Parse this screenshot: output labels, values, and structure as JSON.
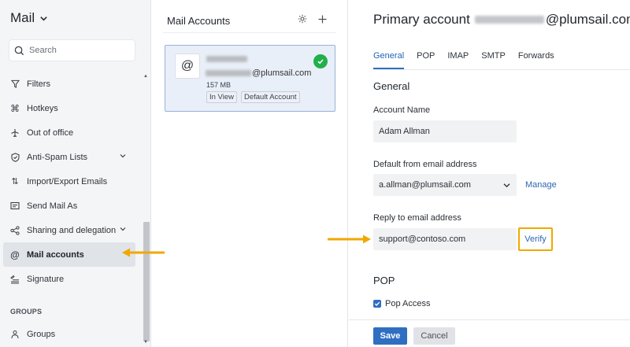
{
  "sidebar": {
    "app_title": "Mail",
    "search_placeholder": "Search",
    "items": [
      {
        "label": "Filters",
        "icon": "filter-icon"
      },
      {
        "label": "Hotkeys",
        "icon": "command-icon"
      },
      {
        "label": "Out of office",
        "icon": "plane-icon"
      },
      {
        "label": "Anti-Spam Lists",
        "icon": "shield-icon",
        "expandable": true
      },
      {
        "label": "Import/Export Emails",
        "icon": "import-export-icon"
      },
      {
        "label": "Send Mail As",
        "icon": "send-as-icon"
      },
      {
        "label": "Sharing and delegation",
        "icon": "share-icon",
        "expandable": true
      },
      {
        "label": "Mail accounts",
        "icon": "at-icon",
        "active": true
      },
      {
        "label": "Signature",
        "icon": "signature-icon"
      }
    ],
    "groups_label": "GROUPS",
    "groups_item": {
      "label": "Groups",
      "icon": "groups-icon"
    }
  },
  "middle": {
    "title": "Mail Accounts",
    "account": {
      "email_domain": "@plumsail.com",
      "size": "157 MB",
      "badges": [
        "In View",
        "Default Account"
      ]
    }
  },
  "right": {
    "title_prefix": "Primary account",
    "title_domain": "@plumsail.com",
    "tabs": [
      "General",
      "POP",
      "IMAP",
      "SMTP",
      "Forwards"
    ],
    "active_tab": "General",
    "general_heading": "General",
    "account_name_label": "Account Name",
    "account_name_value": "Adam Allman",
    "default_from_label": "Default from email address",
    "default_from_value": "a.allman@plumsail.com",
    "manage_link": "Manage",
    "reply_to_label": "Reply to email address",
    "reply_to_value": "support@contoso.com",
    "verify_link": "Verify",
    "pop_heading": "POP",
    "pop_access_label": "Pop Access",
    "pop_access_checked": true,
    "save_label": "Save",
    "cancel_label": "Cancel"
  },
  "colors": {
    "accent": "#2f6fc2",
    "highlight_annotation": "#f0a800",
    "success": "#22b04b"
  }
}
